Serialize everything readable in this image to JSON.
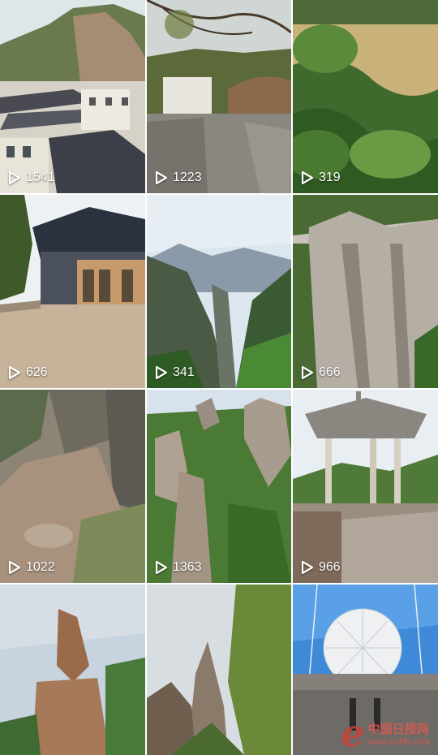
{
  "tiles": [
    {
      "views": "1541",
      "scene": "hotel-buildings"
    },
    {
      "views": "1223",
      "scene": "stone-path-bridge"
    },
    {
      "views": "319",
      "scene": "grass-shrubs"
    },
    {
      "views": "626",
      "scene": "pagoda-hall"
    },
    {
      "views": "341",
      "scene": "valley-peaks"
    },
    {
      "views": "666",
      "scene": "granite-cliff"
    },
    {
      "views": "1022",
      "scene": "rock-ground"
    },
    {
      "views": "1363",
      "scene": "stone-pillars"
    },
    {
      "views": "966",
      "scene": "pavilion"
    },
    {
      "views": "",
      "scene": "flying-rock"
    },
    {
      "views": "",
      "scene": "pine-spires"
    },
    {
      "views": "",
      "scene": "radar-dome"
    }
  ],
  "watermark": {
    "letter": "e",
    "cn": "中国日报网",
    "url": "www.anlife.com"
  },
  "icon": "play-icon"
}
